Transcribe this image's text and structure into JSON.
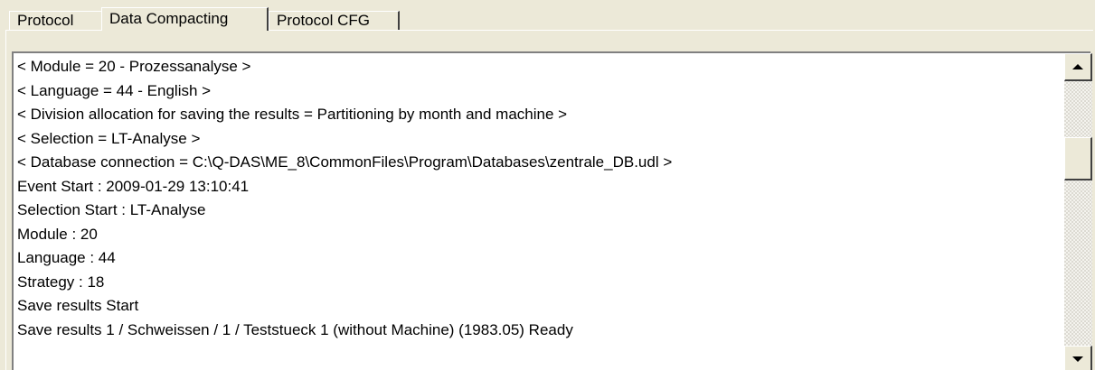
{
  "tabs": [
    {
      "label": "Protocol",
      "active": false
    },
    {
      "label": "Data Compacting",
      "active": true
    },
    {
      "label": "Protocol CFG",
      "active": false
    }
  ],
  "log": {
    "lines": [
      "< Module = 20 - Prozessanalyse >",
      "< Language = 44 - English >",
      "< Division allocation for saving the results = Partitioning by month and machine >",
      "< Selection = LT-Analyse >",
      "< Database connection = C:\\Q-DAS\\ME_8\\CommonFiles\\Program\\Databases\\zentrale_DB.udl >",
      "Event Start : 2009-01-29 13:10:41",
      "Selection Start : LT-Analyse",
      "Module : 20",
      "Language : 44",
      "Strategy : 18",
      "Save results  Start",
      "Save results 1 / Schweissen / 1 / Teststueck 1 (without Machine) (1983.05) Ready"
    ]
  },
  "scrollbar": {
    "up_icon": "arrow-up-icon",
    "down_icon": "arrow-down-icon",
    "position_fraction": 0.31
  }
}
